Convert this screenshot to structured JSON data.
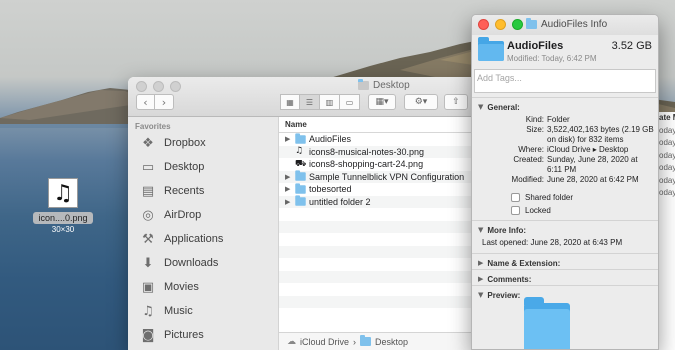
{
  "desktop": {
    "file": {
      "name": "icon....0.png",
      "dims": "30×30",
      "icon": "music-note-icon"
    }
  },
  "finder": {
    "title": "Desktop",
    "sidebar": {
      "section": "Favorites",
      "items": [
        {
          "label": "Dropbox",
          "icon": "dropbox-icon"
        },
        {
          "label": "Desktop",
          "icon": "desktop-icon"
        },
        {
          "label": "Recents",
          "icon": "recents-icon"
        },
        {
          "label": "AirDrop",
          "icon": "airdrop-icon"
        },
        {
          "label": "Applications",
          "icon": "applications-icon"
        },
        {
          "label": "Downloads",
          "icon": "downloads-icon"
        },
        {
          "label": "Movies",
          "icon": "movies-icon"
        },
        {
          "label": "Music",
          "icon": "music-icon"
        },
        {
          "label": "Pictures",
          "icon": "pictures-icon"
        }
      ]
    },
    "list": {
      "header": "Name",
      "rows": [
        {
          "name": "AudioFiles",
          "kind": "folder",
          "expandable": true
        },
        {
          "name": "icons8-musical-notes-30.png",
          "kind": "music-file",
          "expandable": false
        },
        {
          "name": "icons8-shopping-cart-24.png",
          "kind": "cart-file",
          "expandable": false
        },
        {
          "name": "Sample Tunnelblick VPN Configuration",
          "kind": "folder",
          "expandable": true
        },
        {
          "name": "tobesorted",
          "kind": "folder",
          "expandable": true
        },
        {
          "name": "untitled folder 2",
          "kind": "folder",
          "expandable": true
        }
      ]
    },
    "pathbar": {
      "root": "iCloud Drive",
      "separator": "›",
      "current": "Desktop"
    },
    "right_strip": [
      "ate M",
      "oday",
      "oday",
      "oday",
      "oday",
      "oday",
      "oday"
    ]
  },
  "info": {
    "title": "AudioFiles Info",
    "name": "AudioFiles",
    "size": "3.52 GB",
    "modified": "Modified: Today, 6:42 PM",
    "tags_placeholder": "Add Tags...",
    "general_label": "General:",
    "general": [
      {
        "k": "Kind:",
        "v": "Folder"
      },
      {
        "k": "Size:",
        "v": "3,522,402,163 bytes (2.19 GB on disk) for 832 items"
      },
      {
        "k": "Where:",
        "v": "iCloud Drive ▸ Desktop"
      },
      {
        "k": "Created:",
        "v": "Sunday, June 28, 2020 at 6:11 PM"
      },
      {
        "k": "Modified:",
        "v": "June 28, 2020 at 6:42 PM"
      }
    ],
    "shared_folder": "Shared folder",
    "locked": "Locked",
    "more_info_label": "More Info:",
    "last_opened": "Last opened: June 28, 2020 at 6:43 PM",
    "name_ext_label": "Name & Extension:",
    "comments_label": "Comments:",
    "preview_label": "Preview:"
  }
}
